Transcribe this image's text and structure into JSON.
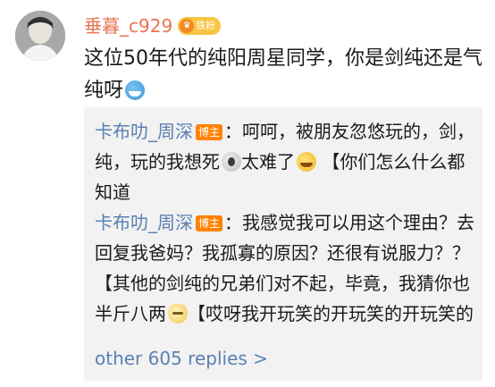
{
  "comment": {
    "username": "垂暮_c929",
    "fan_badge": "铁粉",
    "text": "这位50年代的纯阳周星同学，你是剑纯还是气纯呀",
    "emoji": "smile-blue-emoji"
  },
  "replies": [
    {
      "author": "卡布叻_周深",
      "badge": "博主",
      "text_part1": "：呵呵，被朋友忽悠玩的，剑，纯，玩的我想死",
      "text_part2": "太难了",
      "text_part3": "【你们怎么什么都知道",
      "emojis": [
        "ghost-emoji",
        "crying-emoji"
      ]
    },
    {
      "author": "卡布叻_周深",
      "badge": "博主",
      "text_part1": "：我感觉我可以用这个理由？去回复我爸妈？我孤寡的原因？还很有说服力？？【其他的剑纯的兄弟们对不起，毕竟，我猜你也半斤八两",
      "text_part2": "【哎呀我开玩笑的开玩笑的开玩笑的",
      "emojis": [
        "cat-emoji"
      ]
    }
  ],
  "more_replies": "other 605 replies >",
  "colors": {
    "username": "#eb7350",
    "link": "#5b80b2",
    "host_badge": "#ff8200",
    "fan_badge": "#f7c443",
    "reply_bg": "#f2f2f2"
  }
}
